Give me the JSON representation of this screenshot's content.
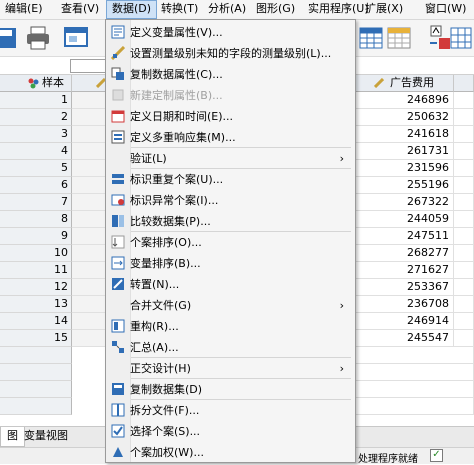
{
  "menubar": {
    "items": [
      "编辑(E)",
      "查看(V)",
      "数据(D)",
      "转换(T)",
      "分析(A)",
      "图形(G)",
      "实用程序(U)",
      "扩展(X)",
      "窗口(W)"
    ]
  },
  "grid": {
    "columns": [
      "样本",
      "广告费用"
    ],
    "rows": [
      {
        "n": "1",
        "ad": "246896"
      },
      {
        "n": "2",
        "ad": "250632"
      },
      {
        "n": "3",
        "ad": "241618"
      },
      {
        "n": "4",
        "ad": "261731"
      },
      {
        "n": "5",
        "ad": "231596"
      },
      {
        "n": "6",
        "ad": "255196"
      },
      {
        "n": "7",
        "ad": "267322"
      },
      {
        "n": "8",
        "ad": "244059"
      },
      {
        "n": "9",
        "ad": "247511"
      },
      {
        "n": "10",
        "ad": "268277"
      },
      {
        "n": "11",
        "ad": "271627"
      },
      {
        "n": "12",
        "ad": "253367"
      },
      {
        "n": "13",
        "ad": "236708"
      },
      {
        "n": "14",
        "ad": "246914"
      },
      {
        "n": "15",
        "ad": "245547"
      }
    ]
  },
  "tabs": [
    "图",
    "变量视图"
  ],
  "status": {
    "text": "处理程序就绪"
  },
  "menu": {
    "items": [
      {
        "label": "定义变量属性(V)...",
        "icon": "define-variable-properties-icon",
        "disabled": false
      },
      {
        "label": "设置测量级别未知的字段的测量级别(L)...",
        "icon": "measurement-level-icon",
        "disabled": false
      },
      {
        "label": "复制数据属性(C)...",
        "icon": "copy-data-properties-icon",
        "disabled": false
      },
      {
        "label": "新建定制属性(B)...",
        "icon": "new-custom-attribute-icon",
        "disabled": true
      },
      {
        "label": "定义日期和时间(E)...",
        "icon": "calendar-icon",
        "disabled": false
      },
      {
        "label": "定义多重响应集(M)...",
        "icon": "multiple-response-icon",
        "disabled": false
      },
      {
        "label": "验证(L)",
        "icon": "",
        "disabled": false,
        "submenu": true
      },
      {
        "label": "标识重复个案(U)...",
        "icon": "duplicate-cases-icon",
        "disabled": false
      },
      {
        "label": "标识异常个案(I)...",
        "icon": "unusual-cases-icon",
        "disabled": false
      },
      {
        "label": "比较数据集(P)...",
        "icon": "compare-datasets-icon",
        "disabled": false
      },
      {
        "label": "个案排序(O)...",
        "icon": "sort-cases-icon",
        "disabled": false
      },
      {
        "label": "变量排序(B)...",
        "icon": "sort-variables-icon",
        "disabled": false
      },
      {
        "label": "转置(N)...",
        "icon": "transpose-icon",
        "disabled": false
      },
      {
        "label": "合并文件(G)",
        "icon": "",
        "disabled": false,
        "submenu": true
      },
      {
        "label": "重构(R)...",
        "icon": "restructure-icon",
        "disabled": false
      },
      {
        "label": "汇总(A)...",
        "icon": "aggregate-icon",
        "disabled": false
      },
      {
        "label": "正交设计(H)",
        "icon": "",
        "disabled": false,
        "submenu": true
      },
      {
        "label": "复制数据集(D)",
        "icon": "copy-dataset-icon",
        "disabled": false
      },
      {
        "label": "拆分文件(F)...",
        "icon": "split-file-icon",
        "disabled": false
      },
      {
        "label": "选择个案(S)...",
        "icon": "select-cases-icon",
        "disabled": false
      },
      {
        "label": "个案加权(W)...",
        "icon": "weight-cases-icon",
        "disabled": false
      }
    ],
    "arrow": "›"
  },
  "colors": {
    "accent": "#2f6db5",
    "menu_bg": "#f5f5f5",
    "header_bg": "#e9edf2"
  }
}
